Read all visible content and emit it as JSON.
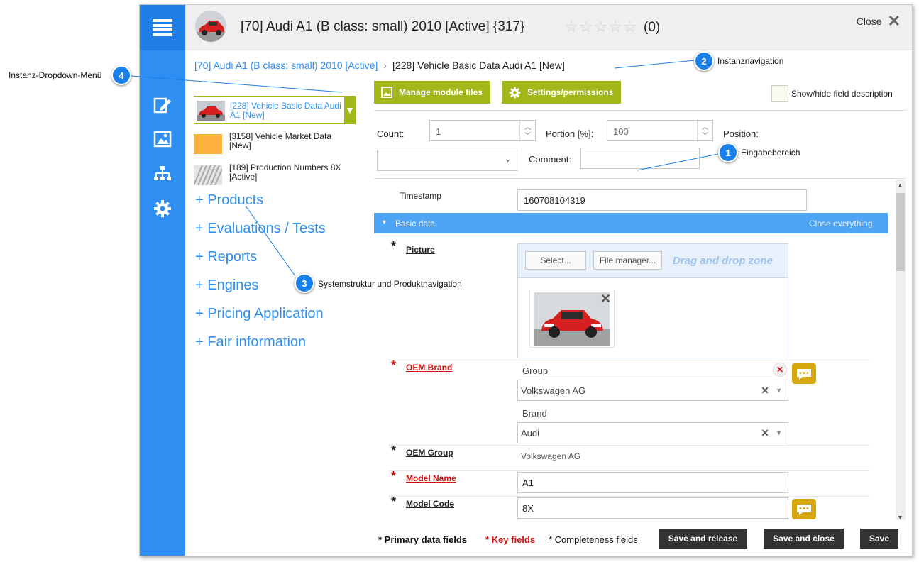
{
  "window": {
    "title": "[70] Audi A1 (B class: small) 2010 [Active] {317}",
    "rating_count": "(0)",
    "close_label": "Close"
  },
  "breadcrumb": {
    "parent": "[70] Audi A1 (B class: small) 2010 [Active]",
    "separator": "›",
    "current": "[228] Vehicle Basic Data Audi A1 [New]"
  },
  "instances": [
    {
      "label": "[228] Vehicle Basic Data Audi A1 [New]",
      "active": true
    },
    {
      "label": "[3158] Vehicle Market Data [New]",
      "active": false
    },
    {
      "label": "[189] Production Numbers 8X [Active]",
      "active": false
    }
  ],
  "nav": [
    {
      "label": "+ Products"
    },
    {
      "label": "+ Evaluations / Tests"
    },
    {
      "label": "+ Reports"
    },
    {
      "label": "+ Engines"
    },
    {
      "label": "+ Pricing Application"
    },
    {
      "label": "+ Fair information"
    }
  ],
  "toolbar": {
    "manage_files": "Manage module files",
    "settings": "Settings/permissions",
    "show_hide": "Show/hide field description"
  },
  "form": {
    "count_label": "Count:",
    "count_value": "1",
    "portion_label": "Portion [%]:",
    "portion_value": "100",
    "position_label": "Position:",
    "comment_label": "Comment:"
  },
  "fields": {
    "timestamp_label": "Timestamp",
    "timestamp_value": "160708104319",
    "section_title": "Basic data",
    "section_action": "Close everything",
    "picture_label": "Picture",
    "select_btn": "Select...",
    "filemanager_btn": "File manager...",
    "drag_zone": "Drag and drop zone",
    "oem_brand_label": "OEM Brand",
    "group_label": "Group",
    "group_value": "Volkswagen AG",
    "brand_label": "Brand",
    "brand_value": "Audi",
    "oem_group_label": "OEM Group",
    "oem_group_value": "Volkswagen AG",
    "model_name_label": "Model Name",
    "model_name_value": "A1",
    "model_code_label": "Model Code",
    "model_code_value": "8X",
    "asterisk": "*"
  },
  "footer": {
    "primary": "* Primary data fields",
    "key": "* Key fields",
    "completeness": "* Completeness fields",
    "save_release": "Save and release",
    "save_close": "Save and close",
    "save": "Save"
  },
  "callouts": [
    {
      "num": "1",
      "text": "Eingabebereich"
    },
    {
      "num": "2",
      "text": "Instanznavigation"
    },
    {
      "num": "3",
      "text": "Systemstruktur und Produktnavigation"
    },
    {
      "num": "4",
      "text": "Instanz-Dropdown-Menü"
    }
  ],
  "colors": {
    "rail": "#2e8ef2",
    "accent_green": "#a2b81a",
    "section_blue": "#4ea5f5",
    "key_red": "#d01010",
    "chat_gold": "#d7a70f",
    "callout_blue": "#1a7fe8"
  },
  "icons": {
    "menu": "hamburger-icon",
    "edit": "edit-icon",
    "image": "image-icon",
    "sitemap": "sitemap-icon",
    "settings": "gear-icon"
  }
}
